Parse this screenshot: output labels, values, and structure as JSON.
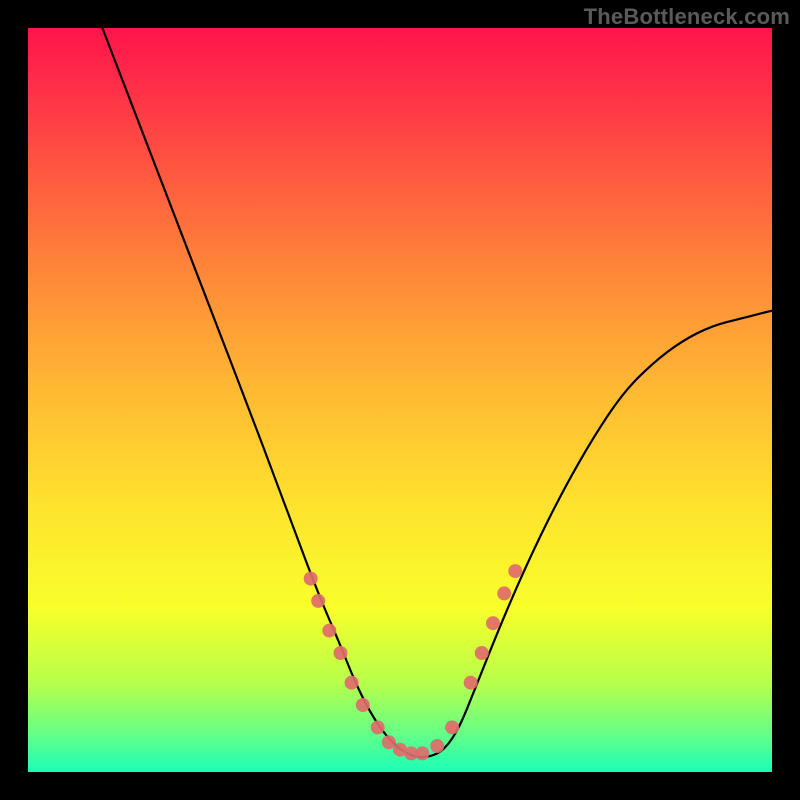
{
  "watermark": "TheBottleneck.com",
  "chart_data": {
    "type": "line",
    "title": "",
    "xlabel": "",
    "ylabel": "",
    "xlim": [
      0,
      100
    ],
    "ylim": [
      0,
      100
    ],
    "grid": false,
    "legend": false,
    "series": [
      {
        "name": "curve",
        "x": [
          10,
          15,
          20,
          25,
          30,
          33,
          36,
          39,
          42,
          44,
          46,
          48,
          50,
          52,
          54,
          56,
          58,
          60,
          64,
          68,
          72,
          76,
          80,
          84,
          88,
          92,
          96,
          100
        ],
        "y": [
          100,
          87,
          74,
          61,
          48,
          40,
          32,
          24,
          17,
          12,
          8,
          5,
          3,
          2,
          2,
          3,
          6,
          11,
          21,
          30,
          38,
          45,
          51,
          55,
          58,
          60,
          61,
          62
        ]
      }
    ],
    "markers": [
      {
        "x": 38.0,
        "y": 26
      },
      {
        "x": 39.0,
        "y": 23
      },
      {
        "x": 40.5,
        "y": 19
      },
      {
        "x": 42.0,
        "y": 16
      },
      {
        "x": 43.5,
        "y": 12
      },
      {
        "x": 45.0,
        "y": 9
      },
      {
        "x": 47.0,
        "y": 6
      },
      {
        "x": 48.5,
        "y": 4
      },
      {
        "x": 50.0,
        "y": 3
      },
      {
        "x": 51.5,
        "y": 2.5
      },
      {
        "x": 53.0,
        "y": 2.5
      },
      {
        "x": 55.0,
        "y": 3.5
      },
      {
        "x": 57.0,
        "y": 6
      },
      {
        "x": 59.5,
        "y": 12
      },
      {
        "x": 61.0,
        "y": 16
      },
      {
        "x": 62.5,
        "y": 20
      },
      {
        "x": 64.0,
        "y": 24
      },
      {
        "x": 65.5,
        "y": 27
      }
    ],
    "marker_radius": 7
  }
}
